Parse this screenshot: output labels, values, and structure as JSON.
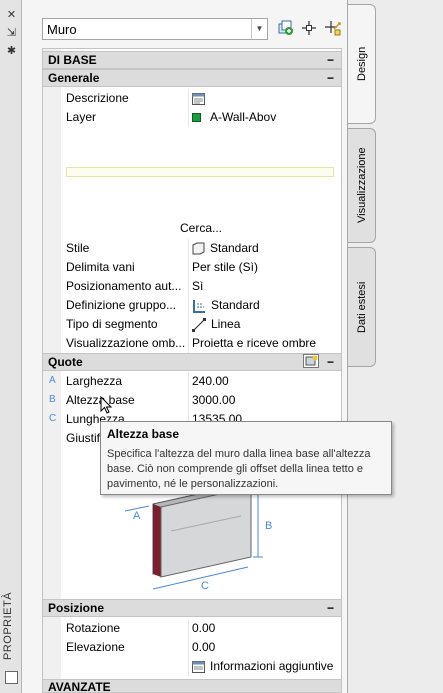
{
  "titlebar": {
    "close": "✕",
    "pin": "⇲",
    "settings": "✱",
    "vertical_title": "PROPRIETÀ"
  },
  "selector": {
    "value": "Muro"
  },
  "tabs": [
    {
      "label": "Design"
    },
    {
      "label": "Visualizzazione"
    },
    {
      "label": "Dati estesi"
    }
  ],
  "categories": {
    "di_base": "DI BASE",
    "generale": "Generale",
    "quote": "Quote",
    "posizione": "Posizione",
    "avanzate": "AVANZATE"
  },
  "generale": {
    "descrizione": {
      "name": "Descrizione",
      "value": ""
    },
    "layer": {
      "name": "Layer",
      "value": "A-Wall-Abov",
      "color": "#1a9c3c"
    },
    "cerca": "Cerca...",
    "stile": {
      "name": "Stile",
      "value": "Standard"
    },
    "delimita": {
      "name": "Delimita vani",
      "value": "Per stile (Sì)"
    },
    "pos_aut": {
      "name": "Posizionamento aut...",
      "value": "Sì"
    },
    "def_gruppo": {
      "name": "Definizione gruppo...",
      "value": "Standard"
    },
    "tipo_segmento": {
      "name": "Tipo di segmento",
      "value": "Linea"
    },
    "vis_omb": {
      "name": "Visualizzazione omb...",
      "value": "Proietta e riceve ombre"
    }
  },
  "quote": {
    "larghezza": {
      "tick": "A",
      "name": "Larghezza",
      "value": "240.00"
    },
    "altezza": {
      "tick": "B",
      "name": "Altezza base",
      "value": "3000.00"
    },
    "lunghezza": {
      "tick": "C",
      "name": "Lunghezza",
      "value": "13535.00"
    },
    "giustif": {
      "name": "Giustif"
    },
    "diagram_labels": {
      "a": "A",
      "b": "B",
      "c": "C"
    }
  },
  "posizione": {
    "rotazione": {
      "name": "Rotazione",
      "value": "0.00"
    },
    "elevazione": {
      "name": "Elevazione",
      "value": "0.00"
    },
    "info": "Informazioni aggiuntive"
  },
  "tooltip": {
    "title": "Altezza base",
    "text": "Specifica l'altezza del muro dalla linea base all'altezza base. Ciò non comprende gli offset della linea tetto e pavimento, né le personalizzazioni."
  }
}
